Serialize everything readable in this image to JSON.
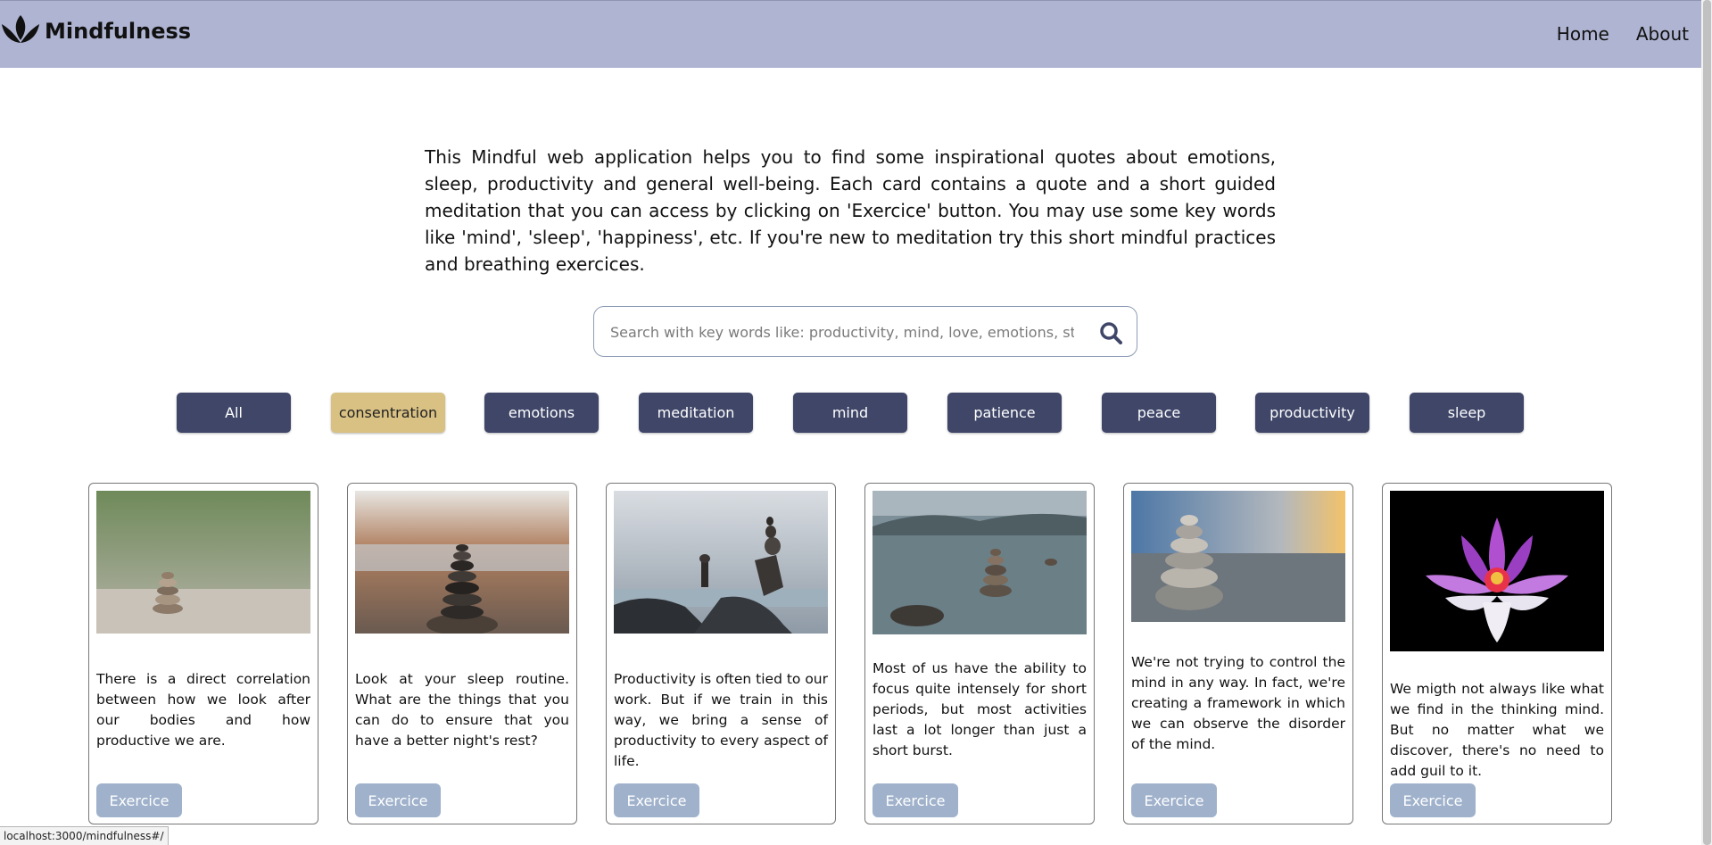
{
  "navbar": {
    "brand": "Mindfulness",
    "links": [
      "Home",
      "About"
    ]
  },
  "intro": {
    "text": "This Mindful web application helps you to find some inspirational quotes about emotions, sleep, productivity and general well-being. Each card contains a quote and a short guided meditation that you can access by clicking on 'Exercice' button. You may use some key words like 'mind', 'sleep', 'happiness', etc. If you're new to meditation try this short mindful practices and breathing exercices."
  },
  "search": {
    "placeholder": "Search with key words like: productivity, mind, love, emotions, stress, etc."
  },
  "filters": [
    "All",
    "consentration",
    "emotions",
    "meditation",
    "mind",
    "patience",
    "peace",
    "productivity",
    "sleep"
  ],
  "active_filter": "consentration",
  "cards": [
    {
      "text": "There is a direct correlation between how we look after our bodies and how productive we are.",
      "button": "Exercice"
    },
    {
      "text": "Look at your sleep routine. What are the things that you can do to ensure that you have a better night's rest?",
      "button": "Exercice"
    },
    {
      "text": "Productivity is often tied to our work. But if we train in this way, we bring a sense of productivity to every aspect of life.",
      "button": "Exercice"
    },
    {
      "text": "Most of us have the ability to focus quite intensely for short periods, but most activities last a lot longer than just a short burst.",
      "button": "Exercice"
    },
    {
      "text": "We're not trying to control the mind in any way. In fact, we're creating a framework in which we can observe the disorder of the mind.",
      "button": "Exercice"
    },
    {
      "text": "We migth not always like what we find in the thinking mind. But no matter what we discover, there's no need to add guil to it.",
      "button": "Exercice"
    }
  ],
  "status_bar": "localhost:3000/mindfulness#/",
  "colors": {
    "navbar": "#aeb4d1",
    "filter": "#3f4668",
    "filter_active": "#d9c184",
    "card_button": "#9fb1cb"
  }
}
